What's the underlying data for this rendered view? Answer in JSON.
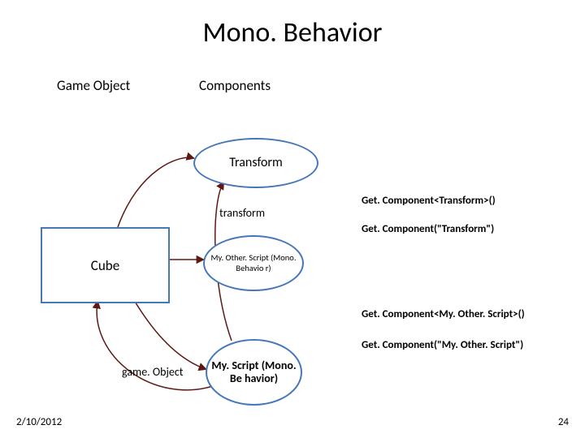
{
  "title": "Mono. Behavior",
  "headings": {
    "game_object": "Game Object",
    "components": "Components"
  },
  "nodes": {
    "cube": "Cube",
    "transform": "Transform",
    "my_other_script": "My. Other. Script (Mono. Behavio r)",
    "my_script": "My. Script (Mono. Be havior)"
  },
  "edge_labels": {
    "transform_prop": "transform",
    "game_object_prop": "game. Object"
  },
  "right_labels": {
    "get_transform_generic": "Get. Component<Transform>()",
    "get_transform_string": "Get. Component(\"Transform\")",
    "get_other_generic": "Get. Component<My. Other. Script>()",
    "get_other_string": "Get. Component(\"My. Other. Script\")"
  },
  "footer": {
    "date": "2/10/2012",
    "slide_number": "24"
  },
  "colors": {
    "accent": "#4678b8",
    "arrow": "#5d1914"
  }
}
